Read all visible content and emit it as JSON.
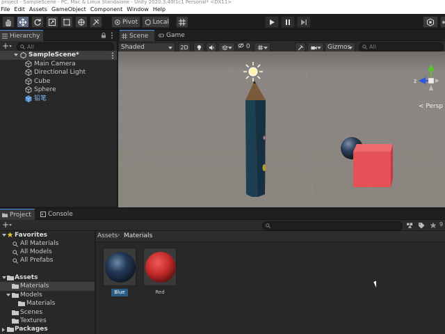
{
  "window": {
    "title": "project - SampleScene - PC, Mac & Linux Standalone - Unity 2020.3.40f1c1 Personal* <DX11>"
  },
  "menu": [
    "File",
    "Edit",
    "Assets",
    "GameObject",
    "Component",
    "Window",
    "Help"
  ],
  "toolbar": {
    "pivot_label": "Pivot",
    "local_label": "Local"
  },
  "hierarchy": {
    "tab_label": "Hierarchy",
    "search_placeholder": "All",
    "add_label": "+",
    "scene_name": "SampleScene*",
    "objects": [
      {
        "name": "Main Camera",
        "icon": "cube-outline-icon"
      },
      {
        "name": "Directional Light",
        "icon": "cube-outline-icon"
      },
      {
        "name": "Cube",
        "icon": "cube-outline-icon"
      },
      {
        "name": "Sphere",
        "icon": "cube-outline-icon"
      },
      {
        "name": "铅笔",
        "icon": "prefab-blue-icon"
      }
    ]
  },
  "scene": {
    "tabs": [
      {
        "label": "Scene",
        "icon": "grid-icon"
      },
      {
        "label": "Game",
        "icon": "gamepad-icon"
      }
    ],
    "shading_mode": "Shaded",
    "mode_2d": "2D",
    "hidden_count": "0",
    "gizmos_label": "Gizmos",
    "search_placeholder": "All",
    "gizmo_axis_label": "z",
    "persp_label": "< Persp"
  },
  "project": {
    "tabs": [
      {
        "label": "Project",
        "icon": "folder-icon"
      },
      {
        "label": "Console",
        "icon": "console-icon"
      }
    ],
    "add_label": "+",
    "breadcrumb": [
      "Assets",
      "Materials"
    ],
    "badge_count": "9",
    "tree": {
      "favorites_label": "Favorites",
      "favorites": [
        "All Materials",
        "All Models",
        "All Prefabs"
      ],
      "assets_label": "Assets",
      "assets": [
        "Materials",
        "Models",
        "Materials",
        "Scenes",
        "Textures"
      ],
      "packages_label": "Packages"
    },
    "materials": [
      {
        "name": "Blue",
        "color": "#1f3a5c"
      },
      {
        "name": "Red",
        "color": "#d23a3a"
      }
    ]
  },
  "colors": {
    "accent": "#4a90e2",
    "red_cube": "#e0484d",
    "pencil_body": "#1d3f52",
    "selection_blue": "#2c5d87"
  }
}
